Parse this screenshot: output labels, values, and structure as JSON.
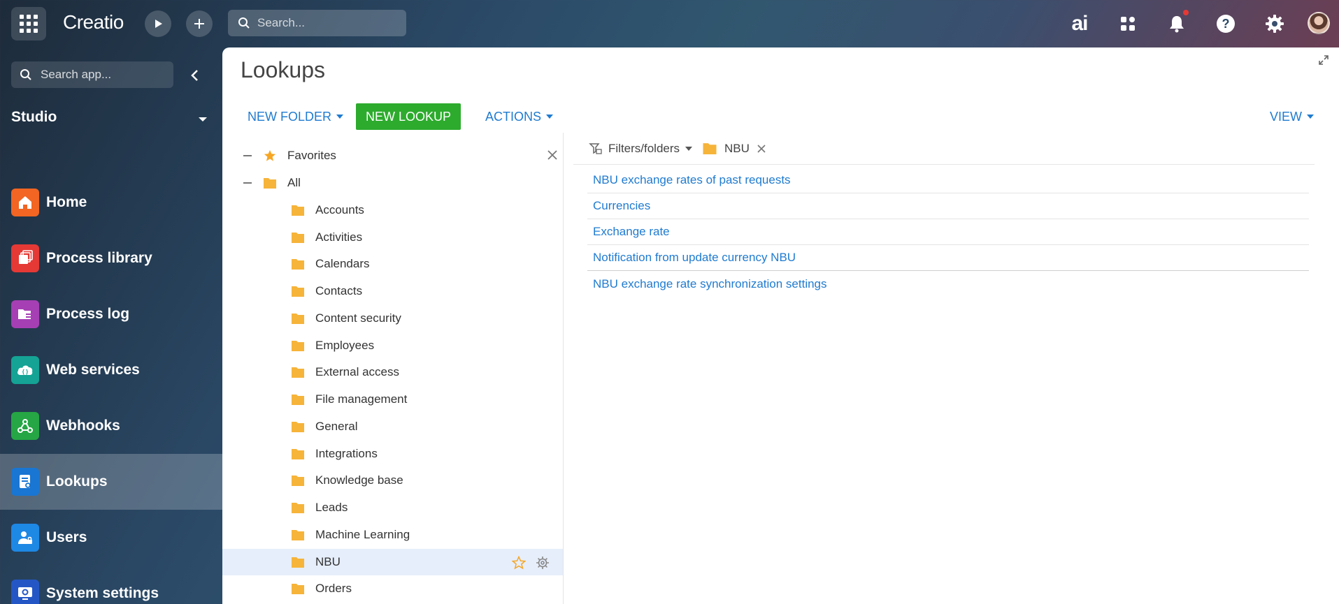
{
  "app": {
    "logo_text": "Creatio"
  },
  "topbar": {
    "search_placeholder": "Search...",
    "ai_label": "ai"
  },
  "sidebar": {
    "search_placeholder": "Search app...",
    "workspace": "Studio",
    "items": [
      {
        "label": "Home",
        "icon": "home-icon",
        "color": "#f26522"
      },
      {
        "label": "Process library",
        "icon": "process-library-icon",
        "color": "#e53935"
      },
      {
        "label": "Process log",
        "icon": "process-log-icon",
        "color": "#a63fb4"
      },
      {
        "label": "Web services",
        "icon": "web-services-icon",
        "color": "#14a395"
      },
      {
        "label": "Webhooks",
        "icon": "webhooks-icon",
        "color": "#26a644"
      },
      {
        "label": "Lookups",
        "icon": "lookups-icon",
        "color": "#1976d2"
      },
      {
        "label": "Users",
        "icon": "users-icon",
        "color": "#1e88e5"
      },
      {
        "label": "System settings",
        "icon": "system-settings-icon",
        "color": "#2457c5"
      }
    ],
    "active_index": 5
  },
  "page": {
    "title": "Lookups",
    "toolbar": {
      "new_folder": "NEW FOLDER",
      "new_lookup": "NEW LOOKUP",
      "actions": "ACTIONS",
      "view": "VIEW"
    }
  },
  "tree": {
    "favorites": "Favorites",
    "all": "All",
    "folders": [
      "Accounts",
      "Activities",
      "Calendars",
      "Contacts",
      "Content security",
      "Employees",
      "External access",
      "File management",
      "General",
      "Integrations",
      "Knowledge base",
      "Leads",
      "Machine Learning",
      "NBU",
      "Orders"
    ],
    "selected": "NBU"
  },
  "filters": {
    "label": "Filters/folders",
    "active_folder": "NBU"
  },
  "lookups": [
    "NBU exchange rates of past requests",
    "Currencies",
    "Exchange rate",
    "Notification from update currency NBU",
    "NBU exchange rate synchronization settings"
  ],
  "colors": {
    "accent": "#1f7bd0",
    "primary_button": "#2dab2d",
    "folder": "#f6b43a",
    "selected_row": "#e6eefb"
  }
}
